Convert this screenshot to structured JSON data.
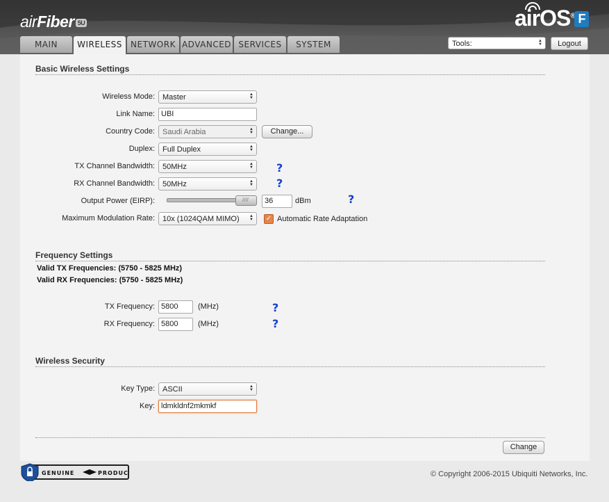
{
  "header": {
    "brand_left_pre": "air",
    "brand_left_main": "Fiber",
    "brand_left_tag": "5U",
    "brand_right": "airOS",
    "brand_right_reg": "®",
    "brand_right_badge": "F"
  },
  "tabs": [
    {
      "label": "MAIN",
      "active": false
    },
    {
      "label": "WIRELESS",
      "active": true
    },
    {
      "label": "NETWORK",
      "active": false
    },
    {
      "label": "ADVANCED",
      "active": false
    },
    {
      "label": "SERVICES",
      "active": false
    },
    {
      "label": "SYSTEM",
      "active": false
    }
  ],
  "toolbar": {
    "tools_value": "Tools:",
    "logout_label": "Logout"
  },
  "basic": {
    "title": "Basic Wireless Settings",
    "wireless_mode": {
      "label": "Wireless Mode:",
      "value": "Master"
    },
    "link_name": {
      "label": "Link Name:",
      "value": "UBI"
    },
    "country_code": {
      "label": "Country Code:",
      "value": "Saudi Arabia",
      "button": "Change..."
    },
    "duplex": {
      "label": "Duplex:",
      "value": "Full Duplex"
    },
    "tx_bw": {
      "label": "TX Channel Bandwidth:",
      "value": "50MHz"
    },
    "rx_bw": {
      "label": "RX Channel Bandwidth:",
      "value": "50MHz"
    },
    "output_power": {
      "label": "Output Power (EIRP):",
      "value": "36",
      "unit": "dBm",
      "slider_fraction": 1.0
    },
    "max_mod": {
      "label": "Maximum Modulation Rate:",
      "value": "10x (1024QAM MIMO)",
      "auto_label": "Automatic Rate Adaptation",
      "auto_checked": true
    },
    "help": "?"
  },
  "frequency": {
    "title": "Frequency Settings",
    "valid_tx": "Valid TX Frequencies: (5750 - 5825 MHz)",
    "valid_rx": "Valid RX Frequencies: (5750 - 5825 MHz)",
    "tx": {
      "label": "TX Frequency:",
      "value": "5800",
      "unit": "(MHz)"
    },
    "rx": {
      "label": "RX Frequency:",
      "value": "5800",
      "unit": "(MHz)"
    }
  },
  "security": {
    "title": "Wireless Security",
    "key_type": {
      "label": "Key Type:",
      "value": "ASCII"
    },
    "key": {
      "label": "Key:",
      "value": "ldmkldnf2mkmkf"
    }
  },
  "footer": {
    "change_label": "Change",
    "genuine_left": "GENUINE",
    "genuine_right": "PRODUCT",
    "copyright": "© Copyright 2006-2015 Ubiquiti Networks, Inc."
  },
  "colors": {
    "accent_orange": "#e8854a",
    "help_blue": "#1a3fd0",
    "brand_blue": "#1e7cc0"
  }
}
